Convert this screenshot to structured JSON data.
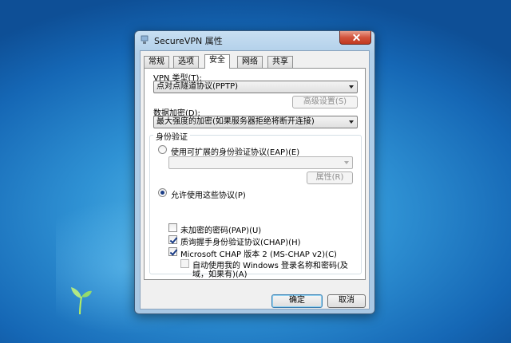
{
  "window": {
    "title": "SecureVPN 属性"
  },
  "tabs": [
    {
      "label": "常规",
      "active": false
    },
    {
      "label": "选项",
      "active": false
    },
    {
      "label": "安全",
      "active": true
    },
    {
      "label": "网络",
      "active": false
    },
    {
      "label": "共享",
      "active": false
    }
  ],
  "security": {
    "vpn_type_label": "VPN 类型(T):",
    "vpn_type_value": "点对点隧道协议(PPTP)",
    "advanced_settings_button": "高级设置(S)",
    "encryption_label": "数据加密(D):",
    "encryption_value": "最大强度的加密(如果服务器拒绝将断开连接)",
    "auth_group_title": "身份验证",
    "eap_radio_label": "使用可扩展的身份验证协议(EAP)(E)",
    "eap_radio_checked": false,
    "eap_combo_value": "",
    "properties_button": "属性(R)",
    "allow_protocols_label": "允许使用这些协议(P)",
    "allow_protocols_checked": true,
    "protocols": [
      {
        "label": "未加密的密码(PAP)(U)",
        "checked": false
      },
      {
        "label": "质询握手身份验证协议(CHAP)(H)",
        "checked": true
      },
      {
        "label": "Microsoft CHAP 版本 2 (MS-CHAP v2)(C)",
        "checked": true
      }
    ],
    "auto_logon_line1": "自动使用我的 Windows 登录名称和密码(及",
    "auto_logon_line2": "域，如果有)(A)",
    "auto_logon_checked": false
  },
  "footer": {
    "ok_button": "确定",
    "cancel_button": "取消"
  }
}
